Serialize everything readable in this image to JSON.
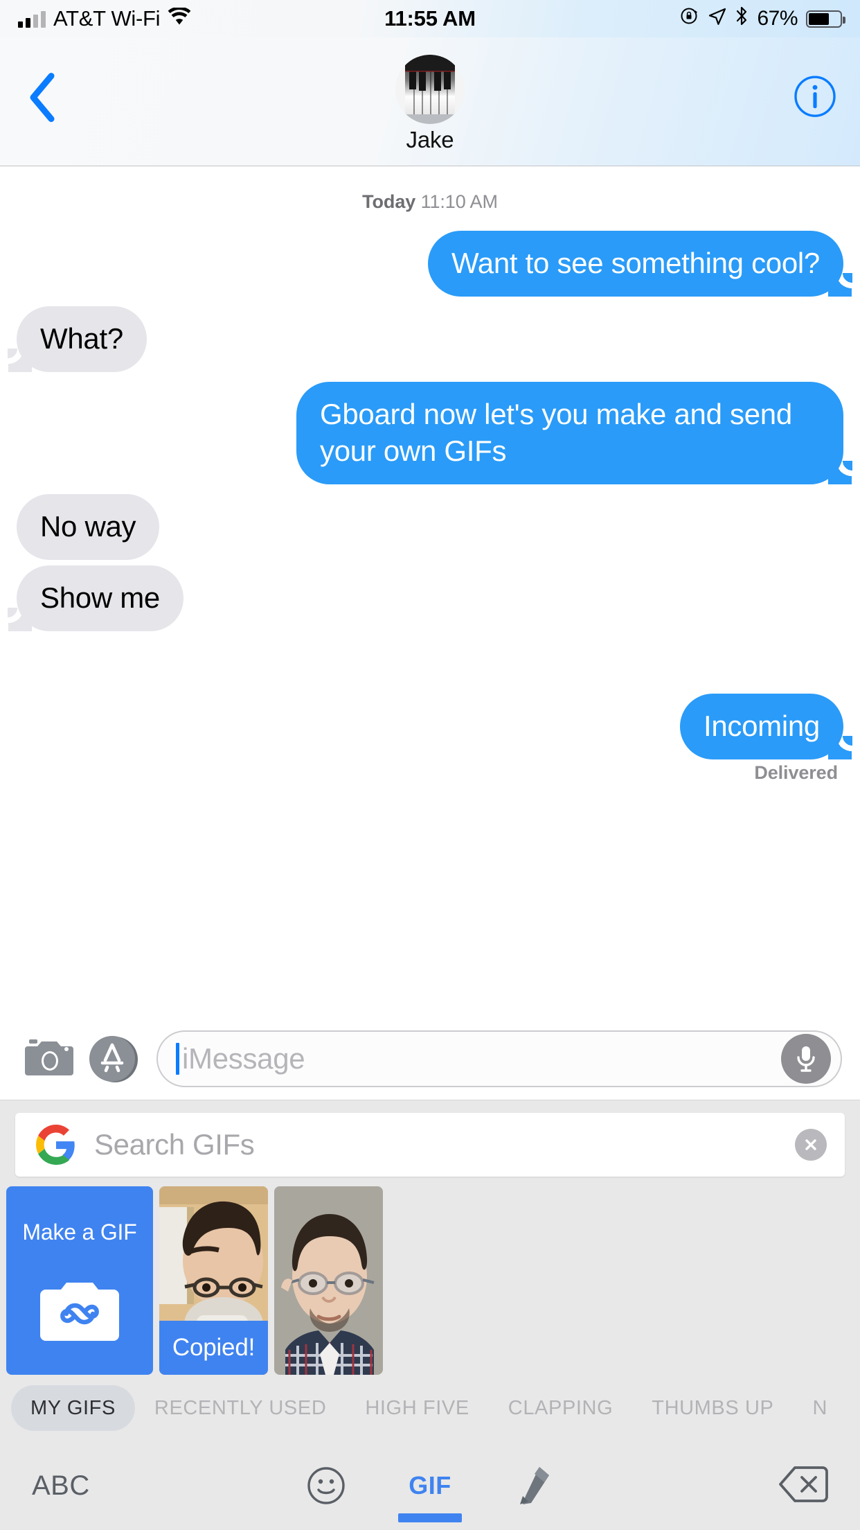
{
  "status_bar": {
    "carrier": "AT&T Wi-Fi",
    "time": "11:55 AM",
    "battery_percent": "67%",
    "icons": [
      "signal-bars-icon",
      "wifi-icon",
      "rotation-lock-icon",
      "location-arrow-icon",
      "bluetooth-icon",
      "battery-icon"
    ]
  },
  "nav_bar": {
    "back_icon": "chevron-left-icon",
    "contact_name": "Jake",
    "avatar_icon": "piano-keys-avatar",
    "info_icon": "info-circle-icon"
  },
  "conversation": {
    "day_label": "Today",
    "day_time": "11:10 AM",
    "messages": [
      {
        "text": "Want to see something cool?",
        "side": "out",
        "tail": true
      },
      {
        "text": "What?",
        "side": "in",
        "tail": true
      },
      {
        "text": "Gboard now let's you make and send your own GIFs",
        "side": "out",
        "tail": true
      },
      {
        "text": "No way",
        "side": "in",
        "tail": false
      },
      {
        "text": "Show me",
        "side": "in",
        "tail": true
      },
      {
        "text": "Incoming",
        "side": "out",
        "tail": true
      }
    ],
    "receipt": "Delivered"
  },
  "input_bar": {
    "camera_icon": "camera-icon",
    "appstore_icon": "app-store-icon",
    "placeholder": "iMessage",
    "mic_icon": "microphone-icon"
  },
  "gif_keyboard": {
    "brand_icon": "google-g-icon",
    "search_placeholder": "Search GIFs",
    "clear_icon": "clear-circle-icon",
    "tiles": [
      {
        "type": "make",
        "label": "Make a GIF",
        "icon": "gif-camera-loop-icon"
      },
      {
        "type": "photo",
        "label": "Copied!",
        "alt": "person-drinking-from-mug"
      },
      {
        "type": "photo",
        "label": "",
        "alt": "person-portrait-plaid-shirt"
      }
    ],
    "categories": [
      {
        "label": "MY GIFS",
        "active": true
      },
      {
        "label": "RECENTLY USED",
        "active": false
      },
      {
        "label": "HIGH FIVE",
        "active": false
      },
      {
        "label": "CLAPPING",
        "active": false
      },
      {
        "label": "THUMBS UP",
        "active": false
      },
      {
        "label": "N",
        "active": false
      }
    ]
  },
  "bottom_bar": {
    "abc_label": "ABC",
    "emoji_icon": "emoji-smiley-icon",
    "gif_label": "GIF",
    "sticker_icon": "marker-pen-icon",
    "backspace_icon": "backspace-icon"
  },
  "colors": {
    "imessage_blue": "#2a9bf8",
    "incoming_gray": "#e5e5ea",
    "google_blue": "#3f83f0",
    "keyboard_bg": "#e8e8e8"
  }
}
